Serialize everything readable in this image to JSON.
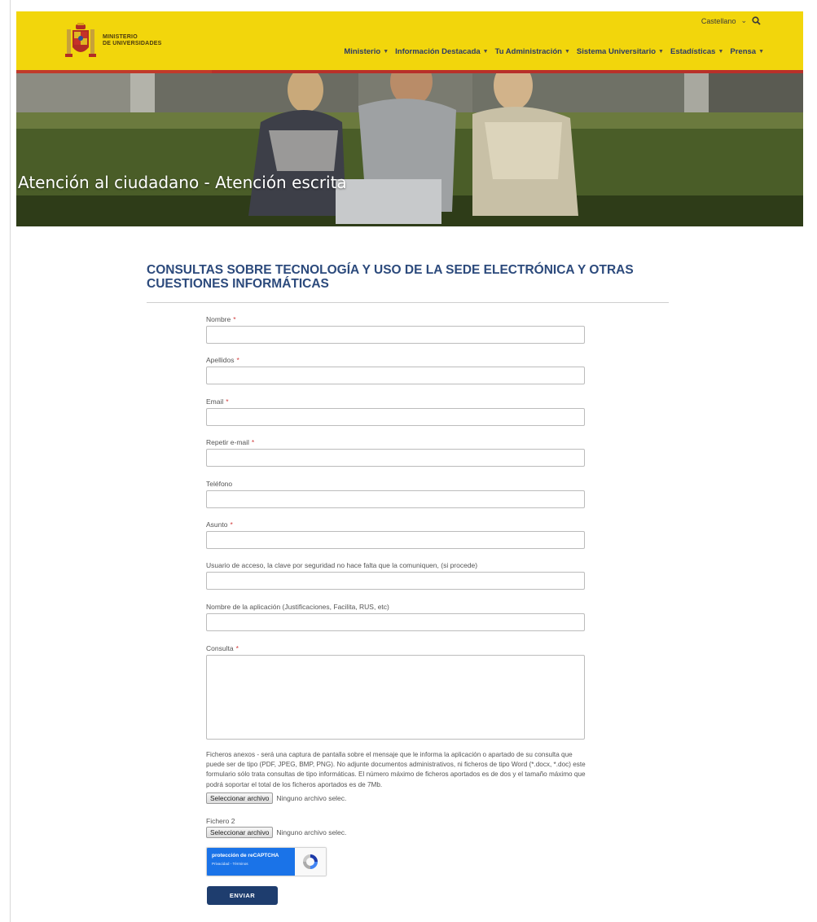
{
  "header": {
    "logo_text_line1": "MINISTERIO",
    "logo_text_line2": "DE UNIVERSIDADES",
    "language": "Castellano",
    "nav": [
      {
        "label": "Ministerio"
      },
      {
        "label": "Información Destacada"
      },
      {
        "label": "Tu Administración"
      },
      {
        "label": "Sistema Universitario"
      },
      {
        "label": "Estadísticas"
      },
      {
        "label": "Prensa"
      }
    ]
  },
  "hero": {
    "title": "Atención al ciudadano - Atención escrita"
  },
  "section": {
    "title": "CONSULTAS SOBRE TECNOLOGÍA Y USO DE LA SEDE ELECTRÓNICA Y OTRAS CUESTIONES INFORMÁTICAS"
  },
  "form": {
    "fields": [
      {
        "label": "Nombre",
        "required": "*",
        "value": ""
      },
      {
        "label": "Apellidos",
        "required": "*",
        "value": ""
      },
      {
        "label": "Email",
        "required": "*",
        "value": ""
      },
      {
        "label": "Repetir e-mail",
        "required": "*",
        "value": ""
      },
      {
        "label": "Teléfono",
        "required": "",
        "value": ""
      },
      {
        "label": "Asunto",
        "required": "*",
        "value": ""
      },
      {
        "label": "Usuario de acceso, la clave por seguridad no hace falta que la comuniquen, (si procede)",
        "required": "",
        "value": ""
      },
      {
        "label": "Nombre de la aplicación (Justificaciones, Facilita, RUS, etc)",
        "required": "",
        "value": ""
      },
      {
        "label": "Consulta",
        "required": "*",
        "value": ""
      }
    ],
    "attachments_help": "Ficheros anexos - será una captura de pantalla sobre el mensaje que le informa la aplicación o apartado de su consulta que puede ser de tipo (PDF, JPEG, BMP, PNG). No adjunte documentos administrativos, ni ficheros de tipo Word (*.docx, *.doc) este formulario sólo trata consultas de tipo informáticas. El número máximo de ficheros aportados es de dos y el tamaño máximo que podrá soportar el total de los ficheros aportados es de 7Mb.",
    "file_button": "Seleccionar archivo",
    "file_status": "Ninguno archivo selec.",
    "file2_label": "Fichero 2",
    "recaptcha_title": "protección de reCAPTCHA",
    "recaptcha_links": "Privacidad - Términos",
    "submit": "ENVIAR"
  },
  "colors": {
    "header_yellow": "#f2d60c",
    "header_red": "#b8302a",
    "title_blue": "#2c4a7c",
    "nav_text": "#2c3a66",
    "submit_bg": "#1e3d6e",
    "required_red": "#d13c3c",
    "recaptcha_blue": "#1a73e8"
  },
  "icons": {
    "search": "search-icon",
    "chevron": "chevron-down-icon",
    "shield": "coat-of-arms-icon",
    "recaptcha": "recaptcha-icon"
  }
}
